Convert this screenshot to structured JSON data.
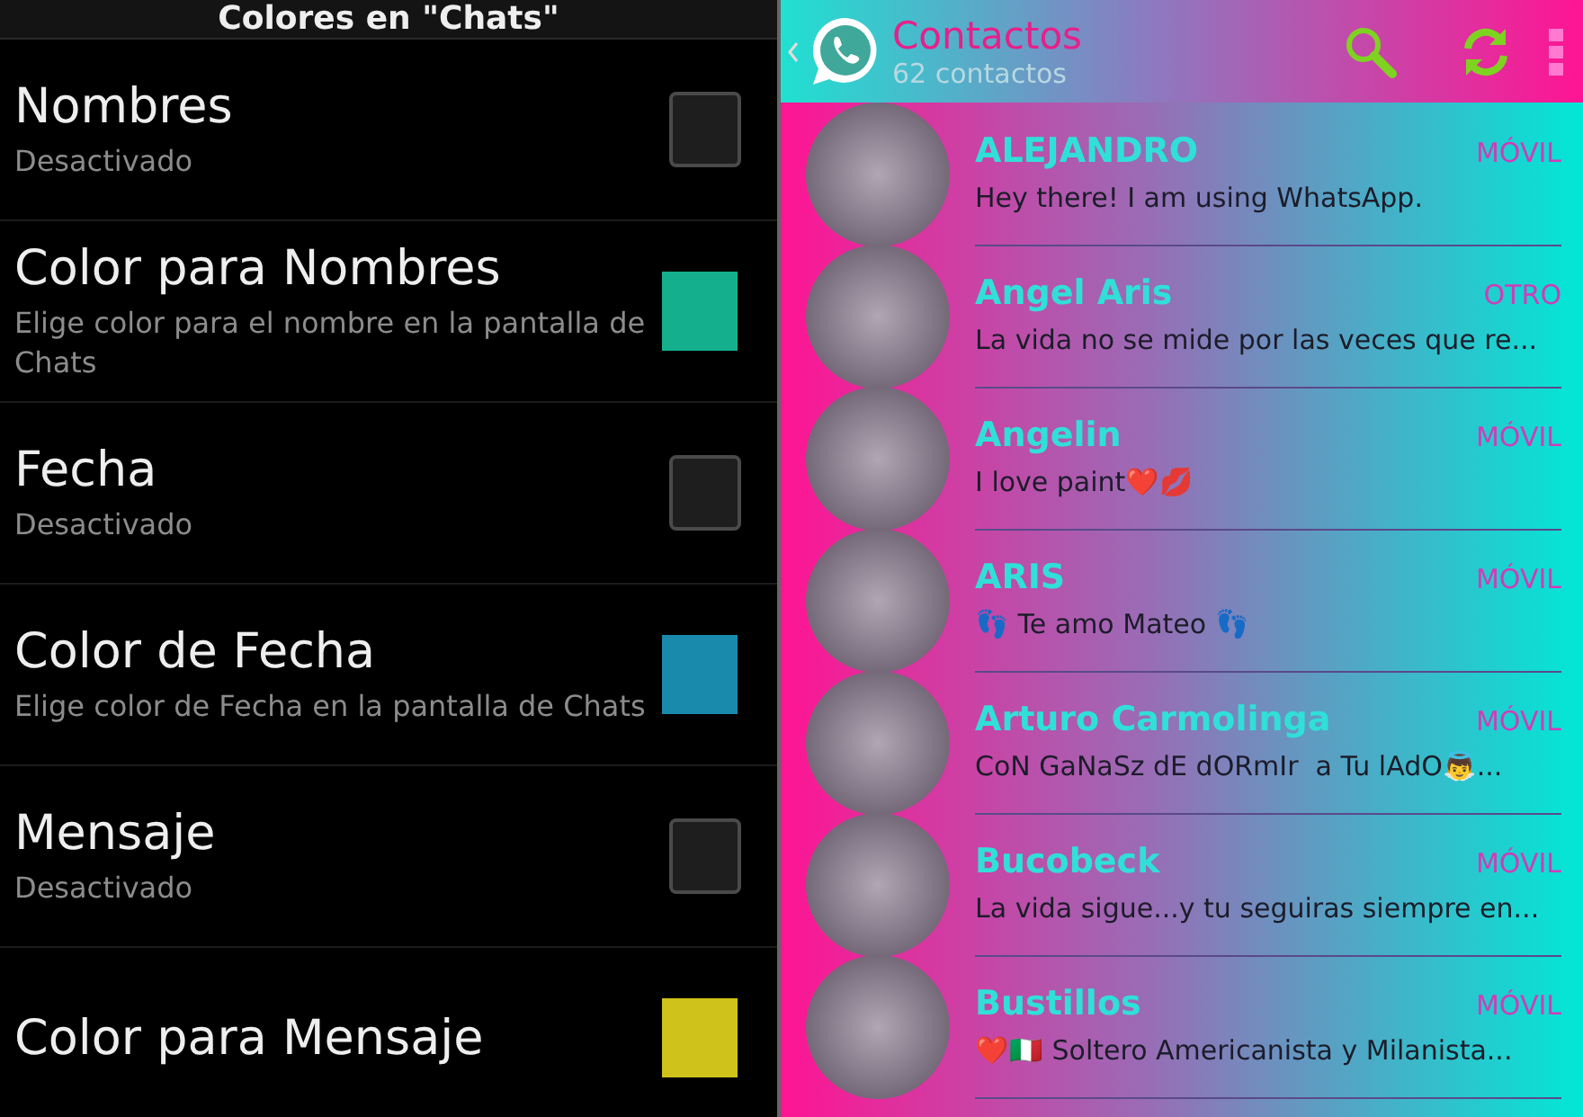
{
  "settings_screen": {
    "title": "Colores en \"Chats\"",
    "items": [
      {
        "kind": "checkbox",
        "title": "Nombres",
        "summary": "Desactivado",
        "checked": false
      },
      {
        "kind": "color",
        "title": "Color para Nombres",
        "summary": "Elige color para el nombre en la pantalla de Chats",
        "color": "#14b08e"
      },
      {
        "kind": "checkbox",
        "title": "Fecha",
        "summary": "Desactivado",
        "checked": false
      },
      {
        "kind": "color",
        "title": "Color de Fecha",
        "summary": "Elige color de Fecha en la pantalla de Chats",
        "color": "#1a8aac"
      },
      {
        "kind": "checkbox",
        "title": "Mensaje",
        "summary": "Desactivado",
        "checked": false
      },
      {
        "kind": "color",
        "title": "Color para Mensaje",
        "color": "#cfc21a"
      }
    ]
  },
  "contacts_screen": {
    "title": "Contactos",
    "subtitle": "62 contactos",
    "contacts": [
      {
        "name": "ALEJANDRO",
        "type": "MÓVIL",
        "status": "Hey there! I am using WhatsApp."
      },
      {
        "name": "Angel Aris",
        "type": "OTRO",
        "status": "La vida no se mide por las veces que re..."
      },
      {
        "name": "Angelin",
        "type": "MÓVIL",
        "status": "I love paint❤️💋"
      },
      {
        "name": "ARIS",
        "type": "MÓVIL",
        "status": "👣 Te amo Mateo 👣"
      },
      {
        "name": "Arturo Carmolinga",
        "type": "MÓVIL",
        "status": "CoN GaNaSz dE dORmIr  a Tu lAdO👼..."
      },
      {
        "name": "Bucobeck",
        "type": "MÓVIL",
        "status": "La vida sigue...y tu seguiras siempre en..."
      },
      {
        "name": "Bustillos",
        "type": "MÓVIL",
        "status": "❤️🇮🇹 Soltero Americanista y Milanista..."
      }
    ]
  }
}
